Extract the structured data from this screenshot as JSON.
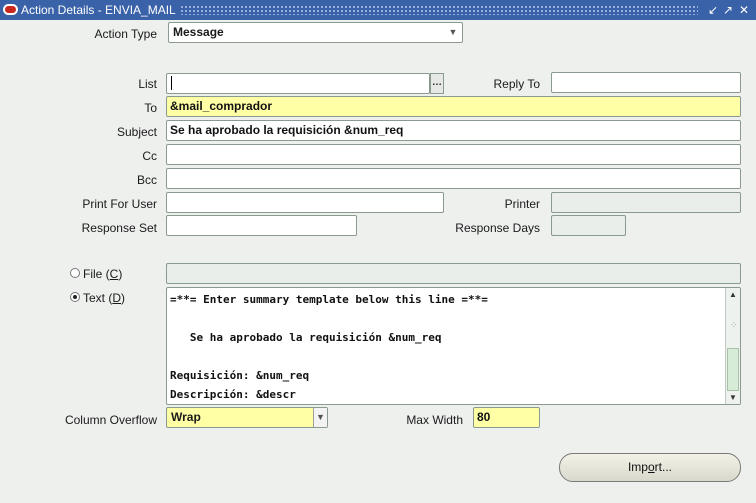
{
  "window": {
    "title": "Action Details - ENVIA_MAIL",
    "controls": [
      "↙",
      "↗",
      "✕"
    ]
  },
  "form": {
    "action_type": {
      "label": "Action Type",
      "value": "Message"
    },
    "list": {
      "label": "List",
      "value": "",
      "lov_glyph": "…"
    },
    "reply_to": {
      "label": "Reply To",
      "value": ""
    },
    "to": {
      "label": "To",
      "value": "&mail_comprador"
    },
    "subject": {
      "label": "Subject",
      "value": "Se ha aprobado la requisición &num_req"
    },
    "cc": {
      "label": "Cc",
      "value": ""
    },
    "bcc": {
      "label": "Bcc",
      "value": ""
    },
    "print_for_user": {
      "label": "Print For User",
      "value": ""
    },
    "printer": {
      "label": "Printer",
      "value": ""
    },
    "response_set": {
      "label": "Response Set",
      "value": ""
    },
    "response_days": {
      "label": "Response Days",
      "value": ""
    },
    "file_option": {
      "label_pre": "File (",
      "accel": "C",
      "label_post": ")",
      "selected": false,
      "value": ""
    },
    "text_option": {
      "label_pre": "Text (",
      "accel": "D",
      "label_post": ")",
      "selected": true
    },
    "text_lines": [
      "=**= Enter summary template below this line =**=",
      "",
      "   Se ha aprobado la requisición &num_req",
      "",
      "Requisición: &num_req",
      "Descripción: &descr"
    ],
    "column_overflow": {
      "label": "Column Overflow",
      "value": "Wrap"
    },
    "max_width": {
      "label": "Max Width",
      "value": "80"
    },
    "import_button": {
      "label_pre": "Imp",
      "accel": "o",
      "label_post": "rt..."
    }
  }
}
